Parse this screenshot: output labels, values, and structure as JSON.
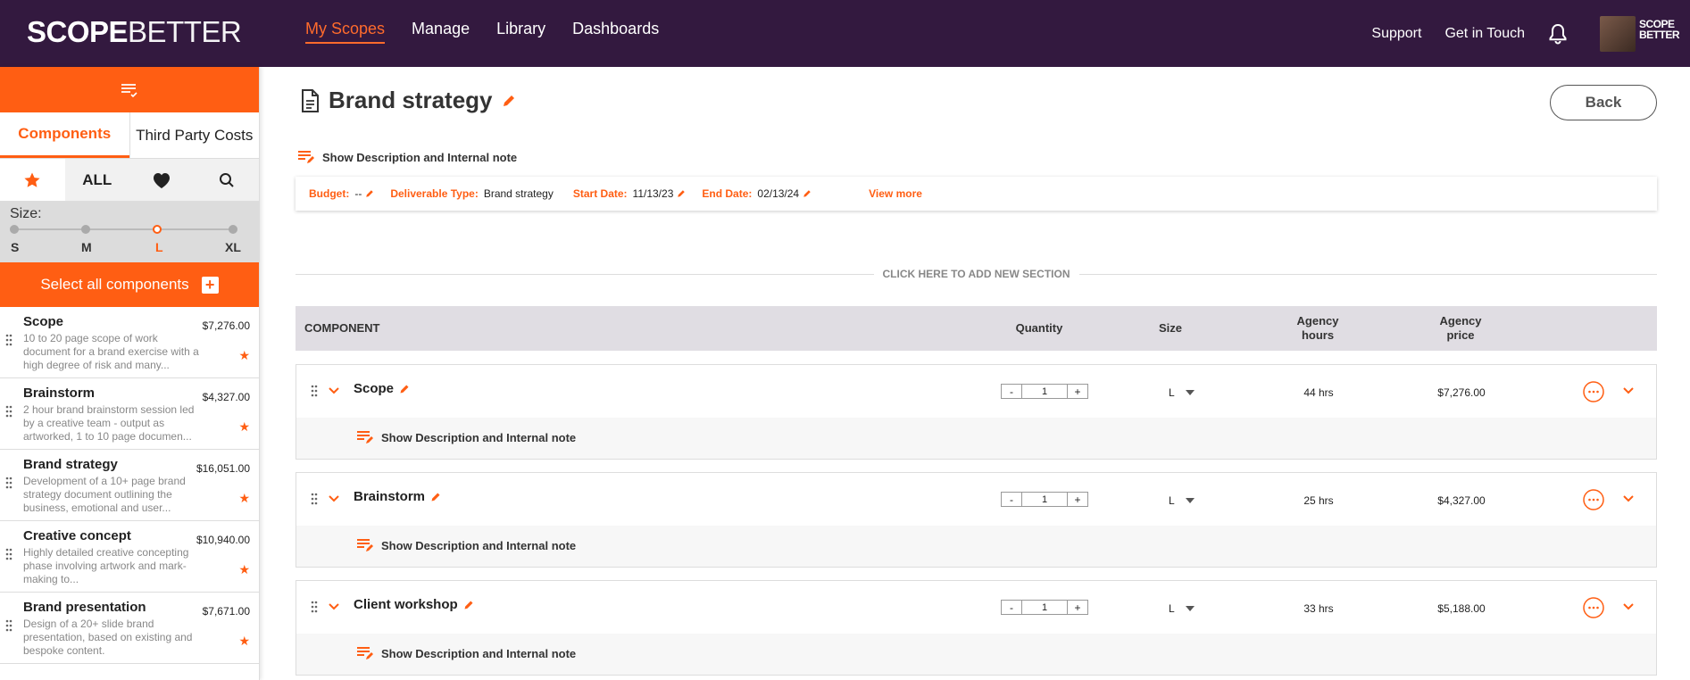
{
  "header": {
    "logo_bold": "SCOPE",
    "logo_light": "BETTER",
    "nav": [
      "My Scopes",
      "Manage",
      "Library",
      "Dashboards"
    ],
    "support": "Support",
    "get_in_touch": "Get in Touch",
    "mini_logo_line1": "SCOPE",
    "mini_logo_line2": "BETTER"
  },
  "sidebar": {
    "tabs": [
      "Components",
      "Third Party Costs"
    ],
    "filter_all": "ALL",
    "size_label": "Size:",
    "sizes": [
      "S",
      "M",
      "L",
      "XL"
    ],
    "selected_size": "L",
    "select_all": "Select all components",
    "items": [
      {
        "name": "Scope",
        "price": "$7,276.00",
        "desc": "10 to 20 page scope of work document for a brand exercise with a high degree of risk and many..."
      },
      {
        "name": "Brainstorm",
        "price": "$4,327.00",
        "desc": "2 hour brand brainstorm session led by a creative team - output as artworked, 1 to 10 page documen..."
      },
      {
        "name": "Brand strategy",
        "price": "$16,051.00",
        "desc": "Development of a 10+ page brand strategy document outlining the business, emotional and user..."
      },
      {
        "name": "Creative concept",
        "price": "$10,940.00",
        "desc": "Highly detailed creative concepting phase involving artwork and mark-making to..."
      },
      {
        "name": "Brand presentation",
        "price": "$7,671.00",
        "desc": "Design of a 20+ slide brand presentation, based on existing and bespoke content."
      }
    ]
  },
  "main": {
    "title": "Brand strategy",
    "back": "Back",
    "show_desc": "Show Description and Internal note",
    "meta": {
      "budget_label": "Budget:",
      "budget_value": "--",
      "deliverable_label": "Deliverable Type:",
      "deliverable_value": "Brand strategy",
      "start_label": "Start Date:",
      "start_value": "11/13/23",
      "end_label": "End Date:",
      "end_value": "02/13/24",
      "view_more": "View more"
    },
    "add_section": "CLICK HERE TO ADD NEW SECTION",
    "columns": {
      "component": "COMPONENT",
      "quantity": "Quantity",
      "size": "Size",
      "agency_hours_1": "Agency",
      "agency_hours_2": "hours",
      "agency_price_1": "Agency",
      "agency_price_2": "price"
    },
    "rows": [
      {
        "name": "Scope",
        "qty": "1",
        "size": "L",
        "hours": "44 hrs",
        "price": "$7,276.00"
      },
      {
        "name": "Brainstorm",
        "qty": "1",
        "size": "L",
        "hours": "25 hrs",
        "price": "$4,327.00"
      },
      {
        "name": "Client workshop",
        "qty": "1",
        "size": "L",
        "hours": "33 hrs",
        "price": "$5,188.00"
      }
    ]
  },
  "colors": {
    "accent": "#ff5e13",
    "header_bg": "#33193f"
  }
}
